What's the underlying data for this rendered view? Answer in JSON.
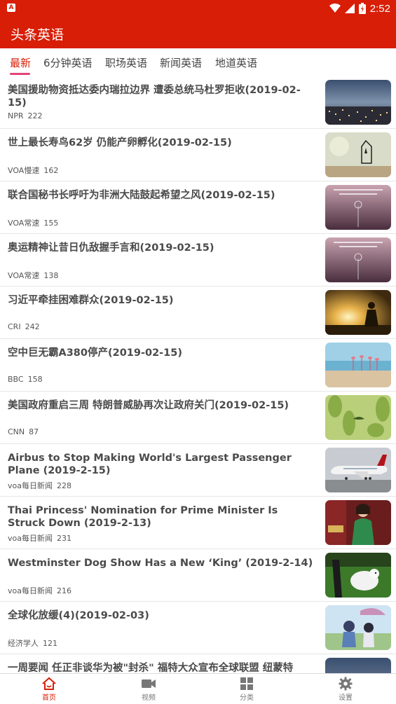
{
  "status": {
    "time": "2:52",
    "app_badge": "A"
  },
  "app": {
    "title": "头条英语"
  },
  "tabs": [
    {
      "label": "最新",
      "active": true
    },
    {
      "label": "6分钟英语",
      "active": false
    },
    {
      "label": "职场英语",
      "active": false
    },
    {
      "label": "新闻英语",
      "active": false
    },
    {
      "label": "地道英语",
      "active": false
    }
  ],
  "items": [
    {
      "title": "美国援助物资抵达委内瑞拉边界 遭委总统马杜罗拒收(2019-02-15)",
      "source": "NPR",
      "count": "222",
      "thumb": "city-night"
    },
    {
      "title": "世上最长寿鸟62岁 仍能产卵孵化(2019-02-15)",
      "source": "VOA慢速",
      "count": "162",
      "thumb": "birdcage"
    },
    {
      "title": "联合国秘书长呼吁为非洲大陆鼓起希望之风(2019-02-15)",
      "source": "VOA常速",
      "count": "155",
      "thumb": "dandelion-quote"
    },
    {
      "title": "奥运精神让昔日仇敌握手言和(2019-02-15)",
      "source": "VOA常速",
      "count": "138",
      "thumb": "dandelion-quote"
    },
    {
      "title": "习近平牵挂困难群众(2019-02-15)",
      "source": "CRI",
      "count": "242",
      "thumb": "sunset-silhouette"
    },
    {
      "title": "空中巨无霸A380停产(2019-02-15)",
      "source": "BBC",
      "count": "158",
      "thumb": "flamingos-beach"
    },
    {
      "title": "美国政府重启三周 特朗普威胁再次让政府关门(2019-02-15)",
      "source": "CNN",
      "count": "87",
      "thumb": "green-leaves"
    },
    {
      "title": "Airbus to Stop Making World's Largest Passenger Plane (2019-2-15)",
      "source": "voa每日新闻",
      "count": "228",
      "thumb": "airplane"
    },
    {
      "title": "Thai Princess' Nomination for Prime Minister Is Struck Down (2019-2-13)",
      "source": "voa每日新闻",
      "count": "231",
      "thumb": "princess"
    },
    {
      "title": "Westminster Dog Show Has a New ‘King’ (2019-2-14)",
      "source": "voa每日新闻",
      "count": "216",
      "thumb": "dog-show"
    },
    {
      "title": "全球化放缓(4)(2019-02-03)",
      "source": "经济学人",
      "count": "121",
      "thumb": "anime"
    },
    {
      "title": "一周要闻 任正非谈华为被\"封杀\" 福特大众宣布全球联盟 纽蒙特",
      "source": "",
      "count": "",
      "thumb": "city-night"
    }
  ],
  "bottom_nav": [
    {
      "label": "首页",
      "icon": "home-icon",
      "active": true
    },
    {
      "label": "视频",
      "icon": "video-icon",
      "active": false
    },
    {
      "label": "分类",
      "icon": "grid-icon",
      "active": false
    },
    {
      "label": "设置",
      "icon": "gear-icon",
      "active": false
    }
  ],
  "colors": {
    "brand": "#d81e06",
    "tab_indicator": "#e5427a"
  }
}
